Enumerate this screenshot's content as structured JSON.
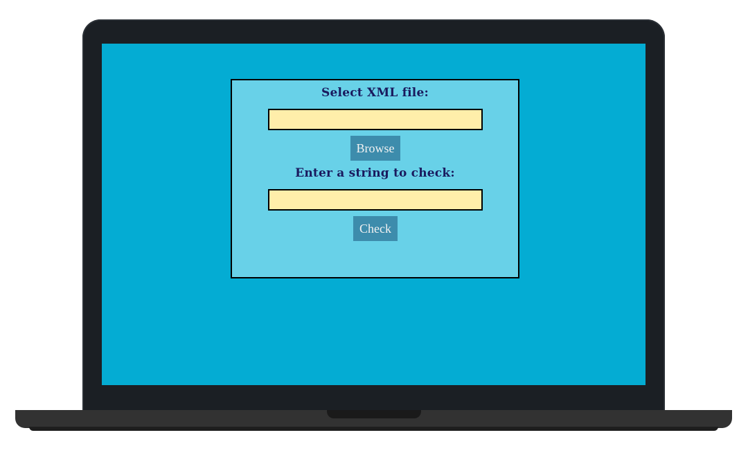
{
  "form": {
    "xml_label": "Select XML file:",
    "xml_value": "",
    "browse_label": "Browse",
    "string_label": "Enter a string to check:",
    "string_value": "",
    "check_label": "Check"
  },
  "colors": {
    "screen_bg": "#04acd3",
    "panel_bg": "#68d1e8",
    "field_bg": "#ffeeaa",
    "button_bg": "#3d8cac",
    "label_text": "#1a1a5e"
  }
}
